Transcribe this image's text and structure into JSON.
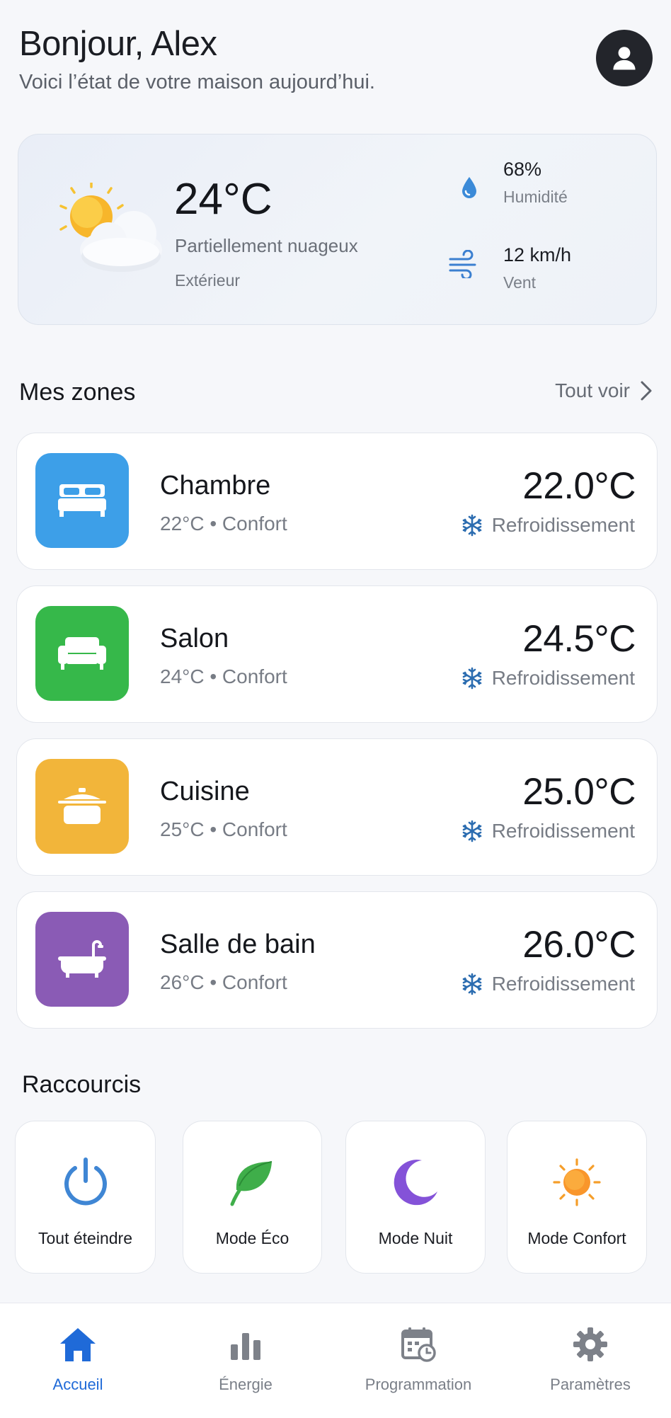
{
  "header": {
    "greeting": "Bonjour, Alex",
    "subtitle": "Voici l’état de votre maison aujourd’hui."
  },
  "weather": {
    "temperature": "24°C",
    "condition": "Partiellement nuageux",
    "location": "Extérieur",
    "humidity_value": "68%",
    "humidity_label": "Humidité",
    "wind_value": "12 km/h",
    "wind_label": "Vent"
  },
  "zones_section": {
    "title": "Mes zones",
    "see_all": "Tout voir"
  },
  "zones": [
    {
      "name": "Chambre",
      "sub": "22°C • Confort",
      "temp": "22.0°C",
      "mode": "Refroidissement",
      "color": "#3d9fe8",
      "icon": "bed-icon"
    },
    {
      "name": "Salon",
      "sub": "24°C • Confort",
      "temp": "24.5°C",
      "mode": "Refroidissement",
      "color": "#36b84a",
      "icon": "sofa-icon"
    },
    {
      "name": "Cuisine",
      "sub": "25°C • Confort",
      "temp": "25.0°C",
      "mode": "Refroidissement",
      "color": "#f2b53a",
      "icon": "pot-icon"
    },
    {
      "name": "Salle de bain",
      "sub": "26°C • Confort",
      "temp": "26.0°C",
      "mode": "Refroidissement",
      "color": "#8a5bb5",
      "icon": "bathtub-icon"
    }
  ],
  "shortcuts_section": {
    "title": "Raccourcis"
  },
  "shortcuts": [
    {
      "label": "Tout éteindre",
      "icon": "power-icon"
    },
    {
      "label": "Mode Éco",
      "icon": "leaf-icon"
    },
    {
      "label": "Mode Nuit",
      "icon": "moon-icon"
    },
    {
      "label": "Mode Confort",
      "icon": "sun-icon"
    }
  ],
  "nav": [
    {
      "label": "Accueil",
      "icon": "home-icon",
      "active": true
    },
    {
      "label": "Énergie",
      "icon": "bar-chart-icon",
      "active": false
    },
    {
      "label": "Programmation",
      "icon": "calendar-clock-icon",
      "active": false
    },
    {
      "label": "Paramètres",
      "icon": "gear-icon",
      "active": false
    }
  ],
  "colors": {
    "accent": "#1f6ad8",
    "snowflake": "#2b6cb0"
  }
}
